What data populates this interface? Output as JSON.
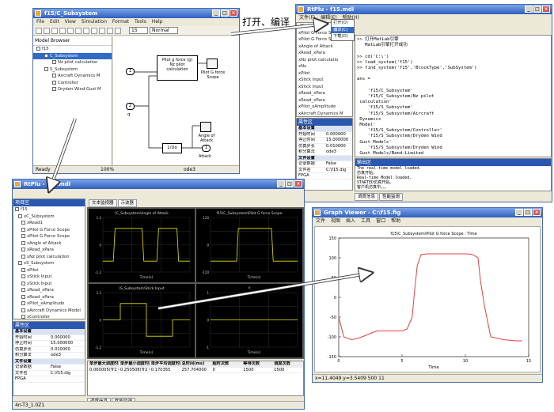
{
  "annotations": {
    "compile": "打开、编译",
    "download": "下载"
  },
  "simulink": {
    "title": "f15/C_Subsystem",
    "menu": [
      "File",
      "Edit",
      "View",
      "Simulation",
      "Format",
      "Tools",
      "Help"
    ],
    "stop_time": "15",
    "mode": "Normal",
    "browser_header": "Model Browser",
    "tree": [
      "f15",
      "C_Subsystem",
      "Nz pilot calculation",
      "S_Subsystem",
      "Aircraft Dynamics M",
      "Controller",
      "Dryden Wind Gust M"
    ],
    "blocks": {
      "nz": "Pilot g force (g)\nNz pilot\ncalculation",
      "scope1": "Pilot G force\nScope",
      "angle": "Angle of\nAttack",
      "tf": "1/Uo",
      "in1": "1",
      "in2": "2",
      "q": "q",
      "out1": "1",
      "out_label": "Attack"
    },
    "status": {
      "ready": "Ready",
      "zoom": "100%",
      "solver": "ode3"
    }
  },
  "ide_top": {
    "title": "RtPlu - f15.mdl",
    "menu": [
      "文件(F)",
      "编辑(E)",
      "帮助(H)"
    ],
    "popup": [
      "打开(O)",
      "编译(C)",
      "下载(D)"
    ],
    "left_tree": [
      "xRodel",
      "xPilot G Force Scope",
      "xPilot G Force Scope",
      "xAngle of Attack",
      "xRead_xPara",
      "xNz pilot calculatio",
      "xNu",
      "xPilot",
      "xStick Input",
      "xStick Input",
      "xRead_xPara",
      "xRead_xPara",
      "xPilot_xAmplitude",
      "xAircraft Dynamics M",
      "xController"
    ],
    "prop_header": "属性区",
    "props": [
      [
        "基本设置",
        ""
      ],
      [
        "开始时间",
        "0.000000"
      ],
      [
        "停止时间",
        "15.000000"
      ],
      [
        "仿真步长",
        "0.010000"
      ],
      [
        "积分算法",
        "ode3"
      ],
      [
        "文件设置",
        ""
      ],
      [
        "记录数据",
        "False"
      ],
      [
        "文件名",
        "C:\\f15.dig"
      ],
      [
        "FPGA",
        ""
      ]
    ],
    "log": ">> 打开MatLab引擎\n   MatLab引擎打开成功\n\n>> cd('C:\\')\n>> load_system('f15')\n>> find_system('f15','BlockType','SubSystem')\n\nans =\n\n    'f15/C_Subsystem'\n    'f15/C_Subsystem/Nz pilot\n calculation'\n    'f15/S_Subsystem'\n    'f15/S_Subsystem/Aircraft\n Dynamics\n Model'\n    'f15/S_Subsystem/Controller'\n    'f15/S_Subsystem/Dryden Wind\n Gust Models'\n    'f15/S_Subsystem/Dryden Wind\n Gust Models/Band-Limited\n White Noise'",
    "output_header": "输出区",
    "output": "The real-time model loaded.\n仿真开始。\nReal-time Model loaded.\nSTARTED仿真开始。\n客户机仿真中。。。",
    "tabs": [
      "调度信息",
      "性能监测"
    ]
  },
  "ide_bottom": {
    "title": "RtPlu - f15.mdl",
    "tree_header": "项目区",
    "tree": [
      "f15",
      "xC_Subsystem",
      "xRead1",
      "xPilot G Force Scope",
      "xPilot G Force Scope",
      "xAngle of Attack",
      "xRead_xPara",
      "xNz pilot calculation",
      "xS_Subsystem",
      "xPilot",
      "xStick Input",
      "xStick Input",
      "xRead_xPara",
      "xRead_xPara",
      "xPilot_xAmplitude",
      "xAircraft Dynamics Model",
      "xController",
      "xDryden Wind Gust Models"
    ],
    "prop_header": "属性区",
    "props": [
      [
        "基本设置",
        ""
      ],
      [
        "开始时间",
        "0.000000"
      ],
      [
        "停止时间",
        "15.000000"
      ],
      [
        "仿真步长",
        "0.010000"
      ],
      [
        "积分算法",
        "ode3"
      ],
      [
        "文件设置",
        ""
      ],
      [
        "记录数据",
        "False"
      ],
      [
        "文件名",
        "C:\\f15.dig"
      ],
      [
        "FPGA",
        ""
      ]
    ],
    "doc_tabs": [
      "文本监视器",
      "示波器"
    ],
    "scopes": [
      {
        "title": "\\C_Subsystem\\Angle of Attack",
        "ylim": [
          -1.2,
          1.2
        ]
      },
      {
        "title": "f15\\C_Subsystem\\Pilot G force Scope",
        "ylim": [
          -120,
          120
        ]
      },
      {
        "title": "\\S_Subsystem\\Stick Input",
        "ylim": [
          -1.2,
          1.2
        ]
      },
      {
        "title": "Y",
        "ylim": [
          -1,
          1
        ]
      }
    ],
    "xlabel": "Time(s)",
    "table_headers": [
      "单步最大调度时间(us)",
      "单步最小调度时间(us)",
      "单步平均调度时间(us)",
      "总时间(ms)",
      "超时次数",
      "等待次数",
      "调度次数"
    ],
    "table_row": [
      "0.060005(Tr2 0006s)",
      "0.250508(Tr2 0106s)",
      "0.170355",
      "257.704000",
      "0",
      "1500",
      "1500"
    ],
    "bottom_tabs": [
      "调度信息",
      "性能监测"
    ],
    "status": "4n-T3_1.0Z1"
  },
  "graph_viewer": {
    "title": "Graph Viewer - C:\\f15.fig",
    "menu": [
      "文件",
      "视图",
      "插入",
      "工具",
      "窗口",
      "帮助"
    ],
    "plot_title": "f15\\C_Subsystem\\Pilot G force Scope : Time",
    "xlabel": "Time",
    "status": "x=11.4049   y=3.5409   500   11",
    "chart_data": {
      "type": "line",
      "title": "f15\\C_Subsystem\\Pilot G force Scope : Time",
      "xlabel": "Time",
      "ylabel": "",
      "xlim": [
        0,
        15
      ],
      "ylim": [
        -150,
        150
      ],
      "xticks": [
        0,
        5,
        10,
        15
      ],
      "yticks": [
        -150,
        -100,
        -50,
        0,
        50,
        100,
        150
      ],
      "series": [
        {
          "x": [
            0,
            0.4,
            1,
            1.5,
            2,
            2.6,
            3,
            4,
            5,
            5.4,
            5.8,
            6,
            6.2,
            6.5,
            7,
            10,
            10.5,
            11,
            11.2,
            11.5,
            12,
            13,
            14,
            14.5
          ],
          "y": [
            -50,
            -100,
            -107,
            -104,
            -98,
            -90,
            -85,
            -85,
            -85,
            -80,
            -50,
            20,
            80,
            108,
            110,
            110,
            109,
            100,
            40,
            -20,
            -100,
            -107,
            -110,
            -110
          ]
        }
      ]
    }
  },
  "colors": {
    "title_bar": "#2f5fbf",
    "scope_bg": "#000000",
    "trace_yellow": "#e6e600",
    "trace_red": "#e04040",
    "grid": "#3a3a3a"
  }
}
